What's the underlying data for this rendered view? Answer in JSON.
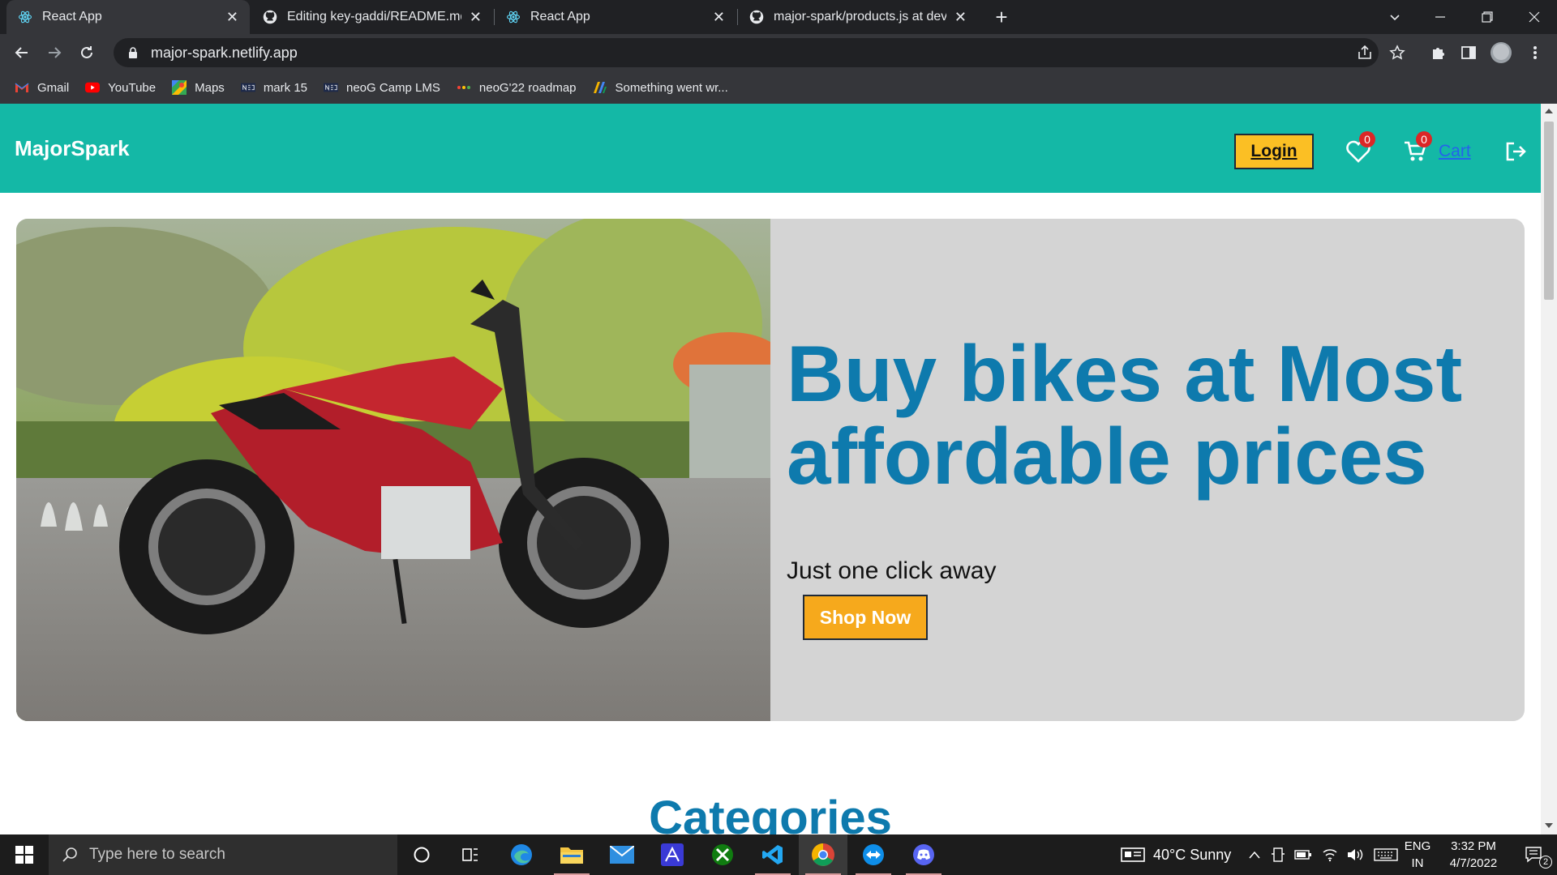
{
  "browser": {
    "tabs": [
      {
        "title": "React App",
        "icon": "react-icon",
        "active": true
      },
      {
        "title": "Editing key-gaddi/README.md a",
        "icon": "github-icon",
        "active": false
      },
      {
        "title": "React App",
        "icon": "react-icon",
        "active": false
      },
      {
        "title": "major-spark/products.js at dev · S",
        "icon": "github-icon",
        "active": false
      }
    ],
    "url": "major-spark.netlify.app",
    "bookmarks": [
      {
        "label": "Gmail",
        "icon": "gmail-icon"
      },
      {
        "label": "YouTube",
        "icon": "youtube-icon"
      },
      {
        "label": "Maps",
        "icon": "maps-icon"
      },
      {
        "label": "mark 15",
        "icon": "neog-icon"
      },
      {
        "label": "neoG Camp LMS",
        "icon": "neog-icon"
      },
      {
        "label": "neoG'22 roadmap",
        "icon": "roadmap-icon"
      },
      {
        "label": "Something went wr...",
        "icon": "app-icon"
      }
    ]
  },
  "site": {
    "brand": "MajorSpark",
    "login_label": "Login",
    "wishlist_count": "0",
    "cart_count": "0",
    "cart_label": "Cart",
    "hero": {
      "title": "Buy bikes at Most affordable prices",
      "subtitle": "Just one click away",
      "cta_label": "Shop Now"
    },
    "categories_heading": "Categories",
    "colors": {
      "navbar": "#14b8a6",
      "accent": "#0e7aad",
      "button": "#fbbf24"
    }
  },
  "taskbar": {
    "search_placeholder": "Type here to search",
    "weather": "40°C  Sunny",
    "lang_top": "ENG",
    "lang_bottom": "IN",
    "time": "3:32 PM",
    "date": "4/7/2022",
    "notification_count": "2"
  }
}
